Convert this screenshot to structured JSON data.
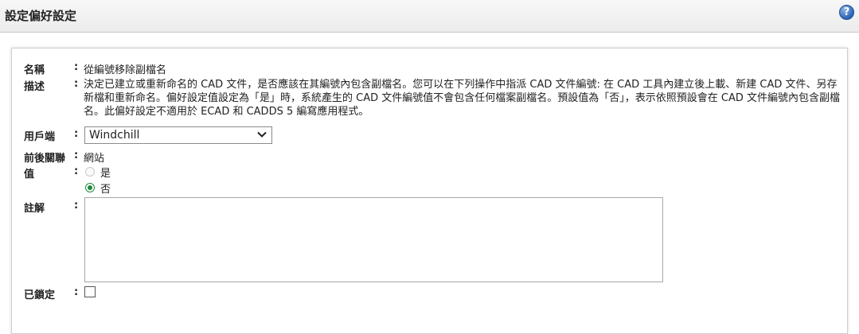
{
  "header": {
    "title": "設定偏好設定",
    "help_icon": "question-icon",
    "help_glyph": "?"
  },
  "form": {
    "colon": ":",
    "name": {
      "label": "名稱",
      "value": "從編號移除副檔名"
    },
    "description": {
      "label": "描述",
      "value": "決定已建立或重新命名的 CAD 文件，是否應該在其編號內包含副檔名。您可以在下列操作中指派 CAD 文件編號: 在 CAD 工具內建立後上載、新建 CAD 文件、另存新檔和重新命名。偏好設定值設定為「是」時，系統產生的 CAD 文件編號值不會包含任何檔案副檔名。預設值為「否」，表示依照預設會在 CAD 文件編號內包含副檔名。此偏好設定不適用於 ECAD 和 CADDS 5 編寫應用程式。"
    },
    "client": {
      "label": "用戶端",
      "selected": "Windchill"
    },
    "context": {
      "label": "前後關聯",
      "value": "網站"
    },
    "value": {
      "label": "值",
      "options": [
        {
          "label": "是",
          "checked": false
        },
        {
          "label": "否",
          "checked": true
        }
      ]
    },
    "comment": {
      "label": "註解",
      "value": ""
    },
    "locked": {
      "label": "已鎖定",
      "checked": false
    }
  },
  "colors": {
    "radio_selected": "#1e8a3a",
    "help_icon": "#2d62b3"
  }
}
